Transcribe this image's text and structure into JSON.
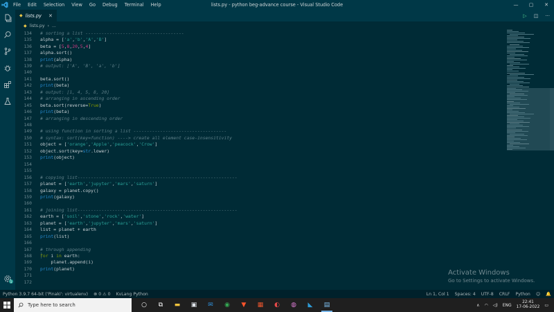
{
  "window": {
    "title": "lists.py - python beg-advance course - Visual Studio Code",
    "menu": [
      "File",
      "Edit",
      "Selection",
      "View",
      "Go",
      "Debug",
      "Terminal",
      "Help"
    ],
    "controls": [
      "—",
      "▢",
      "✕"
    ]
  },
  "tab": {
    "name": "lists.py"
  },
  "breadcrumb": {
    "file": "lists.py",
    "more": "..."
  },
  "editor": {
    "lines": [
      {
        "n": "134",
        "code": "    # sorting a list -------------------------------------"
      },
      {
        "n": "135",
        "code": "    alpha = ['a','b','A','B']"
      },
      {
        "n": "136",
        "code": "    beta = [5,8,20,5,4]"
      },
      {
        "n": "137",
        "code": "    alpha.sort()"
      },
      {
        "n": "138",
        "code": "    print(alpha)"
      },
      {
        "n": "139",
        "code": "    # output: ['A', 'B', 'a', 'b']"
      },
      {
        "n": "140",
        "code": ""
      },
      {
        "n": "141",
        "code": "    beta.sort()"
      },
      {
        "n": "142",
        "code": "    print(beta)"
      },
      {
        "n": "143",
        "code": "    # output: [1, 4, 5, 8, 20]"
      },
      {
        "n": "144",
        "code": "    # arranging in ascending order"
      },
      {
        "n": "145",
        "code": "    beta.sort(reverse=True)"
      },
      {
        "n": "146",
        "code": "    print(beta)"
      },
      {
        "n": "147",
        "code": "    # arranging in descending order"
      },
      {
        "n": "148",
        "code": ""
      },
      {
        "n": "149",
        "code": "    # using function in sorting a list -----------------------------------"
      },
      {
        "n": "150",
        "code": "    # syntax: sort(key=function) ----> create all element case-insensitivity"
      },
      {
        "n": "151",
        "code": "    object = ['orange','Apple','peacock','Crow']"
      },
      {
        "n": "152",
        "code": "    object.sort(key=str.lower)"
      },
      {
        "n": "153",
        "code": "    print(object)"
      },
      {
        "n": "154",
        "code": ""
      },
      {
        "n": "155",
        "code": ""
      },
      {
        "n": "156",
        "code": "    # copying list------------------------------------------------------------"
      },
      {
        "n": "157",
        "code": "    planet = ['earth','jupyter','mars','saturn']"
      },
      {
        "n": "158",
        "code": "    galaxy = planet.copy()"
      },
      {
        "n": "159",
        "code": "    print(galaxy)"
      },
      {
        "n": "160",
        "code": ""
      },
      {
        "n": "161",
        "code": "    # joining list------------------------------------------------------------"
      },
      {
        "n": "162",
        "code": "    earth = ['soil','stone','rock','water']"
      },
      {
        "n": "163",
        "code": "    planet = ['earth','jupyter','mars','saturn']"
      },
      {
        "n": "164",
        "code": "    list = planet + earth"
      },
      {
        "n": "165",
        "code": "    print(list)"
      },
      {
        "n": "166",
        "code": ""
      },
      {
        "n": "167",
        "code": "    # through appending"
      },
      {
        "n": "168",
        "code": "    for i in earth:"
      },
      {
        "n": "169",
        "code": "        planet.append(i)"
      },
      {
        "n": "170",
        "code": "    print(planet)"
      },
      {
        "n": "171",
        "code": ""
      },
      {
        "n": "172",
        "code": ""
      }
    ]
  },
  "watermark": {
    "title": "Activate Windows",
    "subtitle": "Go to Settings to activate Windows."
  },
  "statusbar": {
    "interpreter": "Python 3.9.7 64-bit ('Pinaki': virtualenv)",
    "problems": "⊗ 0 ⚠ 0",
    "kvlang": "KvLang Python",
    "position": "Ln 1, Col 1",
    "spaces": "Spaces: 4",
    "encoding": "UTF-8",
    "eol": "CRLF",
    "language": "Python"
  },
  "taskbar": {
    "search_placeholder": "Type here to search",
    "language": "ENG",
    "time": "22:41",
    "date": "17-06-2022"
  },
  "colors": {
    "editor_bg": "#002b36",
    "comment": "#5e7f88",
    "string": "#2aa198",
    "function": "#268bd2",
    "keyword": "#859900"
  }
}
